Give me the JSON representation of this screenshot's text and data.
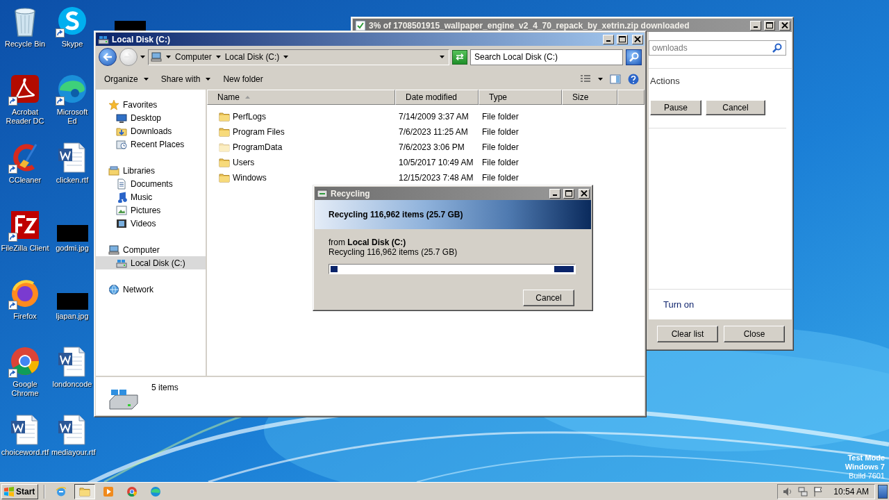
{
  "desktop_icons": [
    [
      {
        "label": "Recycle Bin",
        "kind": "recycle_bin",
        "shortcut": false
      },
      {
        "label": "Acrobat Reader DC",
        "kind": "acrobat",
        "shortcut": true
      },
      {
        "label": "CCleaner",
        "kind": "ccleaner",
        "shortcut": true
      },
      {
        "label": "FileZilla Client",
        "kind": "filezilla",
        "shortcut": true
      },
      {
        "label": "Firefox",
        "kind": "firefox",
        "shortcut": true
      },
      {
        "label": "Google Chrome",
        "kind": "chrome",
        "shortcut": true
      },
      {
        "label": "choiceword.rtf",
        "kind": "word",
        "shortcut": false
      }
    ],
    [
      {
        "label": "Skype",
        "kind": "skype",
        "shortcut": true
      },
      {
        "label": "Microsoft Ed",
        "kind": "edge",
        "shortcut": true
      },
      {
        "label": "clicken.rtf",
        "kind": "word",
        "shortcut": false
      },
      {
        "label": "godmi.jpg",
        "kind": "thumbnail",
        "shortcut": false
      },
      {
        "label": "ljapan.jpg",
        "kind": "thumbnail",
        "shortcut": false
      },
      {
        "label": "londoncode",
        "kind": "word",
        "shortcut": false
      },
      {
        "label": "mediayour.rtf",
        "kind": "word",
        "shortcut": false
      }
    ],
    [
      {
        "kind": "thumbnail",
        "shortcut": false
      }
    ]
  ],
  "download_window": {
    "title": "3% of 1708501915_wallpaper_engine_v2_4_70_repack_by_xetrin.zip downloaded",
    "active": false,
    "search_placeholder": "ownloads",
    "section": "Actions",
    "buttons": [
      "Pause",
      "Cancel"
    ],
    "link": "Turn on",
    "footer_buttons": [
      "Clear list",
      "Close"
    ]
  },
  "explorer": {
    "title": "Local Disk (C:)",
    "active": true,
    "forward_disabled": true,
    "breadcrumb": [
      "Computer",
      "Local Disk (C:)"
    ],
    "search_placeholder": "Search Local Disk (C:)",
    "toolbar": [
      {
        "label": "Organize",
        "dropdown": true
      },
      {
        "label": "Share with",
        "dropdown": true
      },
      {
        "label": "New folder",
        "dropdown": false
      }
    ],
    "nav": [
      {
        "label": "Favorites",
        "kind": "star",
        "selected": false,
        "children": [
          {
            "label": "Desktop",
            "kind": "desktop",
            "selected": false
          },
          {
            "label": "Downloads",
            "kind": "downloads",
            "selected": false
          },
          {
            "label": "Recent Places",
            "kind": "recent",
            "selected": false
          }
        ]
      },
      {
        "label": "Libraries",
        "kind": "libraries",
        "selected": false,
        "children": [
          {
            "label": "Documents",
            "kind": "documents",
            "selected": false
          },
          {
            "label": "Music",
            "kind": "music",
            "selected": false
          },
          {
            "label": "Pictures",
            "kind": "pictures",
            "selected": false
          },
          {
            "label": "Videos",
            "kind": "videos",
            "selected": false
          }
        ]
      },
      {
        "label": "Computer",
        "kind": "computer",
        "selected": false,
        "children": [
          {
            "label": "Local Disk (C:)",
            "kind": "drive",
            "selected": true
          }
        ]
      },
      {
        "label": "Network",
        "kind": "network",
        "selected": false
      }
    ],
    "columns": [
      {
        "label": "Name",
        "sorted": true
      },
      {
        "label": "Date modified",
        "sorted": false
      },
      {
        "label": "Type",
        "sorted": false
      },
      {
        "label": "Size",
        "sorted": false
      }
    ],
    "rows": [
      {
        "name": "PerfLogs",
        "date": "7/14/2009 3:37 AM",
        "type": "File folder",
        "hidden": false
      },
      {
        "name": "Program Files",
        "date": "7/6/2023 11:25 AM",
        "type": "File folder",
        "hidden": false
      },
      {
        "name": "ProgramData",
        "date": "7/6/2023 3:06 PM",
        "type": "File folder",
        "hidden": true
      },
      {
        "name": "Users",
        "date": "10/5/2017 10:49 AM",
        "type": "File folder",
        "hidden": false
      },
      {
        "name": "Windows",
        "date": "12/15/2023 7:48 AM",
        "type": "File folder",
        "hidden": false
      }
    ],
    "status": "5 items"
  },
  "dialog": {
    "title": "Recycling",
    "active": false,
    "indeterminate": true,
    "header": "Recycling 116,962 items (25.7 GB)",
    "from": "from **Local Disk (C:)**",
    "detail": "Recycling 116,962 items (25.7 GB)",
    "button": "Cancel"
  },
  "taskbar": {
    "start": "Start",
    "apps": [
      {
        "kind": "ie",
        "selected": false
      },
      {
        "kind": "folder",
        "selected": true
      },
      {
        "kind": "media",
        "selected": false
      },
      {
        "kind": "chrome",
        "selected": false
      },
      {
        "kind": "edge",
        "selected": false
      }
    ],
    "clock": "10:54 AM"
  },
  "test_mode": [
    {
      "text": "Test Mode",
      "bold": true
    },
    {
      "text": "Windows 7",
      "bold": true
    },
    {
      "text": "Build 7601",
      "bold": false
    }
  ]
}
